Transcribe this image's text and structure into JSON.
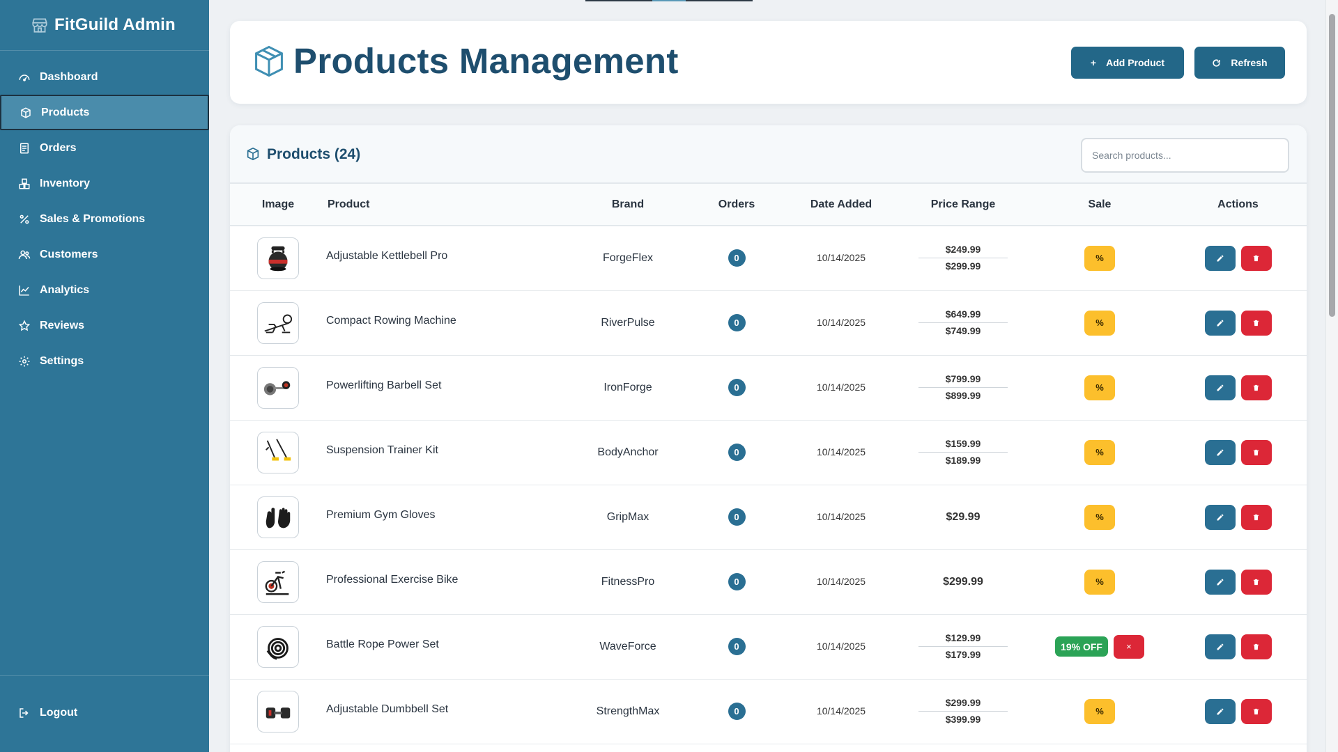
{
  "sidebar": {
    "brand": "FitGuild Admin",
    "items": [
      {
        "label": "Dashboard",
        "icon": "dashboard-icon"
      },
      {
        "label": "Products",
        "icon": "box-icon",
        "active": true
      },
      {
        "label": "Orders",
        "icon": "receipt-icon"
      },
      {
        "label": "Inventory",
        "icon": "boxes-icon"
      },
      {
        "label": "Sales & Promotions",
        "icon": "percent-icon"
      },
      {
        "label": "Customers",
        "icon": "users-icon"
      },
      {
        "label": "Analytics",
        "icon": "chart-line-icon"
      },
      {
        "label": "Reviews",
        "icon": "star-icon"
      },
      {
        "label": "Settings",
        "icon": "gear-icon"
      }
    ],
    "logout": "Logout"
  },
  "header": {
    "title": "Products Management",
    "add_label": "Add Product",
    "refresh_label": "Refresh"
  },
  "products_panel": {
    "title": "Products (24)",
    "search_placeholder": "Search products..."
  },
  "table": {
    "columns": [
      "Image",
      "Product",
      "Brand",
      "Orders",
      "Date Added",
      "Price Range",
      "Sale",
      "Actions"
    ],
    "rows": [
      {
        "name": "Adjustable Kettlebell Pro",
        "brand": "ForgeFlex",
        "orders": "0",
        "date": "10/14/2025",
        "price_low": "$249.99",
        "price_high": "$299.99",
        "sale": null,
        "image": "kettlebell-image"
      },
      {
        "name": "Compact Rowing Machine",
        "brand": "RiverPulse",
        "orders": "0",
        "date": "10/14/2025",
        "price_low": "$649.99",
        "price_high": "$749.99",
        "sale": null,
        "image": "rowing-machine-image"
      },
      {
        "name": "Powerlifting Barbell Set",
        "brand": "IronForge",
        "orders": "0",
        "date": "10/14/2025",
        "price_low": "$799.99",
        "price_high": "$899.99",
        "sale": null,
        "image": "barbell-image"
      },
      {
        "name": "Suspension Trainer Kit",
        "brand": "BodyAnchor",
        "orders": "0",
        "date": "10/14/2025",
        "price_low": "$159.99",
        "price_high": "$189.99",
        "sale": null,
        "image": "suspension-trainer-image"
      },
      {
        "name": "Premium Gym Gloves",
        "brand": "GripMax",
        "orders": "0",
        "date": "10/14/2025",
        "price": "$29.99",
        "sale": null,
        "image": "gloves-image"
      },
      {
        "name": "Professional Exercise Bike",
        "brand": "FitnessPro",
        "orders": "0",
        "date": "10/14/2025",
        "price": "$299.99",
        "sale": null,
        "image": "exercise-bike-image"
      },
      {
        "name": "Battle Rope Power Set",
        "brand": "WaveForce",
        "orders": "0",
        "date": "10/14/2025",
        "price_low": "$129.99",
        "price_high": "$179.99",
        "sale": "19% OFF",
        "image": "battle-rope-image"
      },
      {
        "name": "Adjustable Dumbbell Set",
        "brand": "StrengthMax",
        "orders": "0",
        "date": "10/14/2025",
        "price_low": "$299.99",
        "price_high": "$399.99",
        "sale": null,
        "image": "dumbbell-image"
      }
    ]
  },
  "glyphs": {
    "percent": "%",
    "remove": "×",
    "plus": "+"
  },
  "colors": {
    "sidebar": "#2e7597",
    "primary": "#236788",
    "danger": "#dc2737",
    "warning": "#fcbf2c",
    "success": "#2ba356"
  }
}
